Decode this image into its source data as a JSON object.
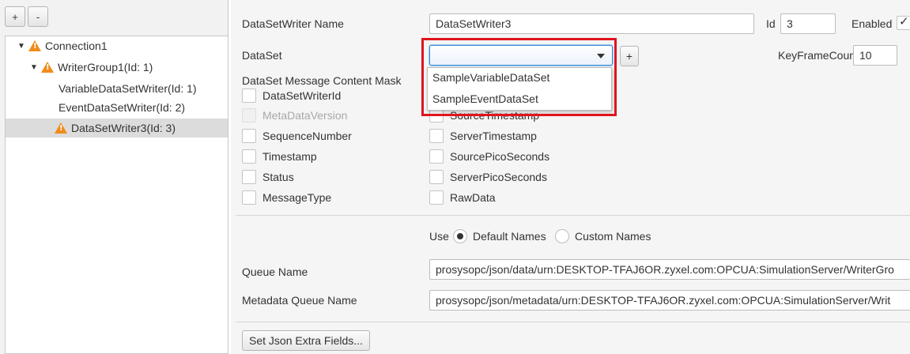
{
  "toolbar": {
    "add_label": "+",
    "remove_label": "-"
  },
  "tree": {
    "connection": "Connection1",
    "writer_group": "WriterGroup1(Id: 1)",
    "variable_writer": "VariableDataSetWriter(Id: 1)",
    "event_writer": "EventDataSetWriter(Id: 2)",
    "selected_writer": "DataSetWriter3(Id: 3)"
  },
  "form": {
    "writer_name_label": "DataSetWriter Name",
    "writer_name_value": "DataSetWriter3",
    "id_label": "Id",
    "id_value": "3",
    "enabled_label": "Enabled",
    "dataset_label": "DataSet",
    "dataset_add_label": "+",
    "keyframe_label": "KeyFrameCount",
    "keyframe_value": "10",
    "mask_label": "DataSet Message Content Mask",
    "dataset_options": [
      "SampleVariableDataSet",
      "SampleEventDataSet"
    ]
  },
  "mask": {
    "left": [
      {
        "label": "DataSetWriterId",
        "disabled": false
      },
      {
        "label": "MetaDataVersion",
        "disabled": true
      },
      {
        "label": "SequenceNumber",
        "disabled": false
      },
      {
        "label": "Timestamp",
        "disabled": false
      },
      {
        "label": "Status",
        "disabled": false
      },
      {
        "label": "MessageType",
        "disabled": false
      }
    ],
    "right": [
      {
        "label": "SourceTimestamp"
      },
      {
        "label": "ServerTimestamp"
      },
      {
        "label": "SourcePicoSeconds"
      },
      {
        "label": "ServerPicoSeconds"
      },
      {
        "label": "RawData"
      }
    ]
  },
  "names": {
    "use_label": "Use",
    "default_label": "Default Names",
    "custom_label": "Custom Names",
    "queue_label": "Queue Name",
    "queue_value": "prosysopc/json/data/urn:DESKTOP-TFAJ6OR.zyxel.com:OPCUA:SimulationServer/WriterGro",
    "metadata_queue_label": "Metadata Queue Name",
    "metadata_queue_value": "prosysopc/json/metadata/urn:DESKTOP-TFAJ6OR.zyxel.com:OPCUA:SimulationServer/Writ"
  },
  "extra_fields_label": "Set Json Extra Fields...",
  "colors": {
    "highlight": "#e0141e",
    "warning": "#f08c1a",
    "focus": "#3c8ed6"
  }
}
